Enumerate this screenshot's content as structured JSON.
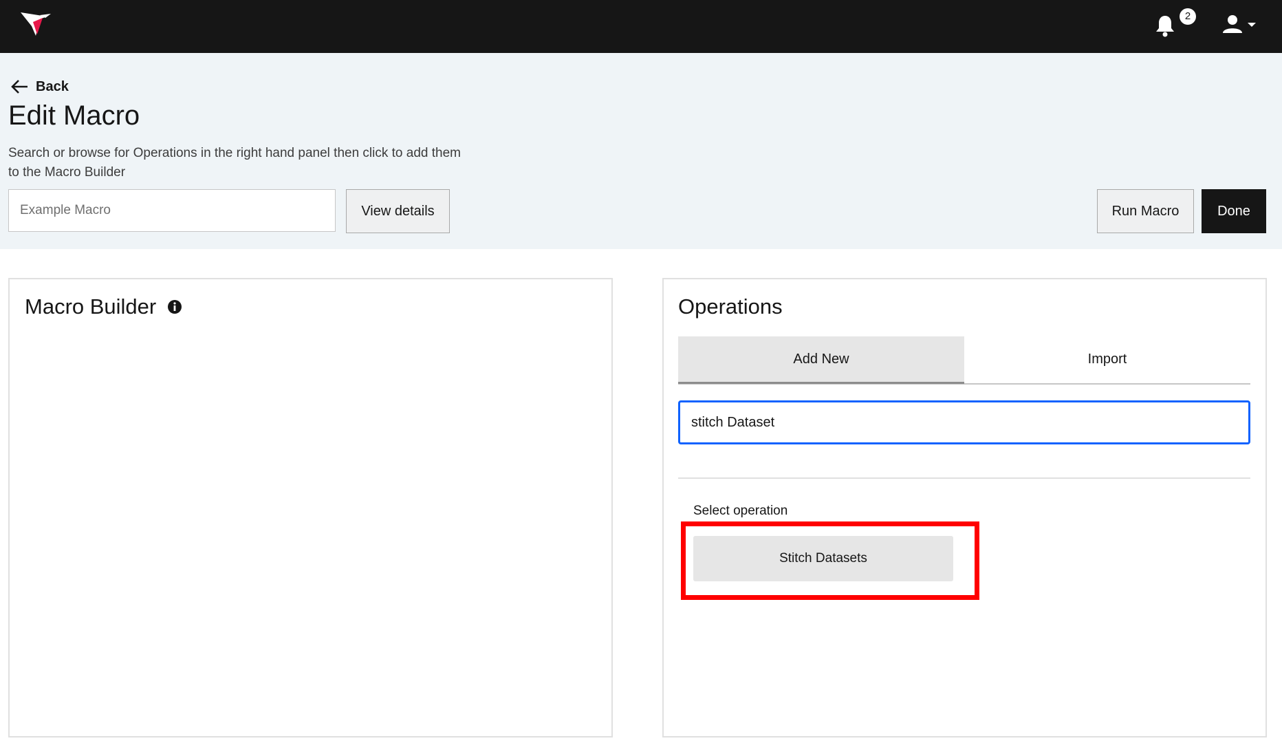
{
  "topbar": {
    "notification_count": "2",
    "icons": [
      "hummingbird-logo",
      "bell-icon",
      "user-icon",
      "caret-down-icon"
    ]
  },
  "header": {
    "back_label": "Back",
    "title": "Edit Macro",
    "description": "Search or browse for Operations in the right hand panel then click to add them to the Macro Builder",
    "macro_name_placeholder": "Example Macro",
    "view_details_label": "View details",
    "run_macro_label": "Run Macro",
    "done_label": "Done"
  },
  "macro_builder": {
    "title": "Macro Builder"
  },
  "operations": {
    "title": "Operations",
    "tabs": [
      {
        "label": "Add New",
        "active": true
      },
      {
        "label": "Import",
        "active": false
      }
    ],
    "search_value": "stitch Dataset",
    "select_label": "Select operation",
    "results": [
      "Stitch Datasets"
    ]
  },
  "colors": {
    "topbar": "#161616",
    "header_band": "#eff4f7",
    "focus_border": "#0f62fe",
    "highlight": "#ff0000"
  }
}
